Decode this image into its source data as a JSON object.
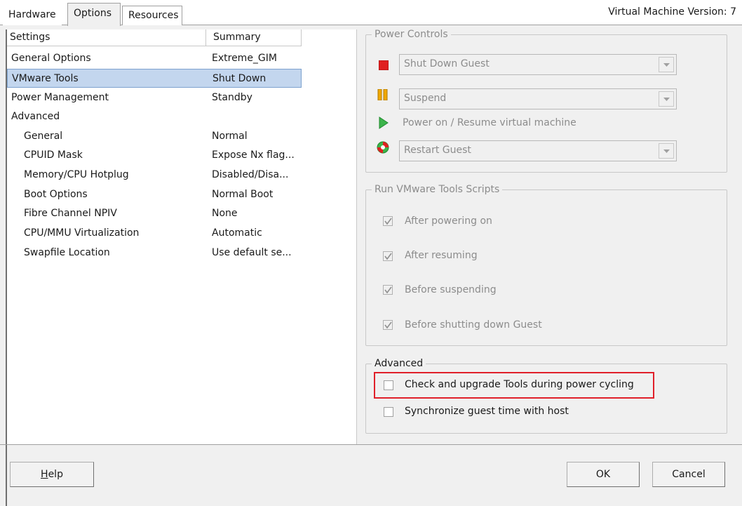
{
  "tabs": [
    {
      "label": "Hardware"
    },
    {
      "label": "Options"
    },
    {
      "label": "Resources"
    }
  ],
  "vm_version": "Virtual Machine Version: 7",
  "settings_list": {
    "headers": {
      "settings": "Settings",
      "summary": "Summary"
    },
    "rows": [
      {
        "setting": "General Options",
        "summary": "Extreme_GIM"
      },
      {
        "setting": "VMware Tools",
        "summary": "Shut Down"
      },
      {
        "setting": "Power Management",
        "summary": "Standby"
      },
      {
        "setting": "Advanced",
        "summary": ""
      },
      {
        "setting": "General",
        "summary": "Normal"
      },
      {
        "setting": "CPUID Mask",
        "summary": "Expose Nx flag..."
      },
      {
        "setting": "Memory/CPU Hotplug",
        "summary": "Disabled/Disa..."
      },
      {
        "setting": "Boot Options",
        "summary": "Normal Boot"
      },
      {
        "setting": "Fibre Channel NPIV",
        "summary": "None"
      },
      {
        "setting": "CPU/MMU Virtualization",
        "summary": "Automatic"
      },
      {
        "setting": "Swapfile Location",
        "summary": "Use default se..."
      }
    ]
  },
  "power_controls": {
    "legend": "Power Controls",
    "stop_value": "Shut Down Guest",
    "pause_value": "Suspend",
    "power_on_label": "Power on / Resume virtual machine",
    "restart_value": "Restart Guest"
  },
  "scripts": {
    "legend": "Run VMware Tools Scripts",
    "items": [
      {
        "label": "After powering on",
        "checked": true
      },
      {
        "label": "After resuming",
        "checked": true
      },
      {
        "label": "Before suspending",
        "checked": true
      },
      {
        "label": "Before shutting down Guest",
        "checked": true
      }
    ]
  },
  "advanced": {
    "legend": "Advanced",
    "upgrade_label": "Check and upgrade Tools during power cycling",
    "sync_label": "Synchronize guest time with host"
  },
  "buttons": {
    "help": "elp",
    "help_accel": "H",
    "ok": "OK",
    "cancel": "Cancel"
  },
  "colors": {
    "selection": "#c3d6ee",
    "highlight_box": "#e0202a",
    "stop_icon": "#e02020",
    "pause_icon": "#f0a800",
    "play_icon": "#3cb44b"
  }
}
